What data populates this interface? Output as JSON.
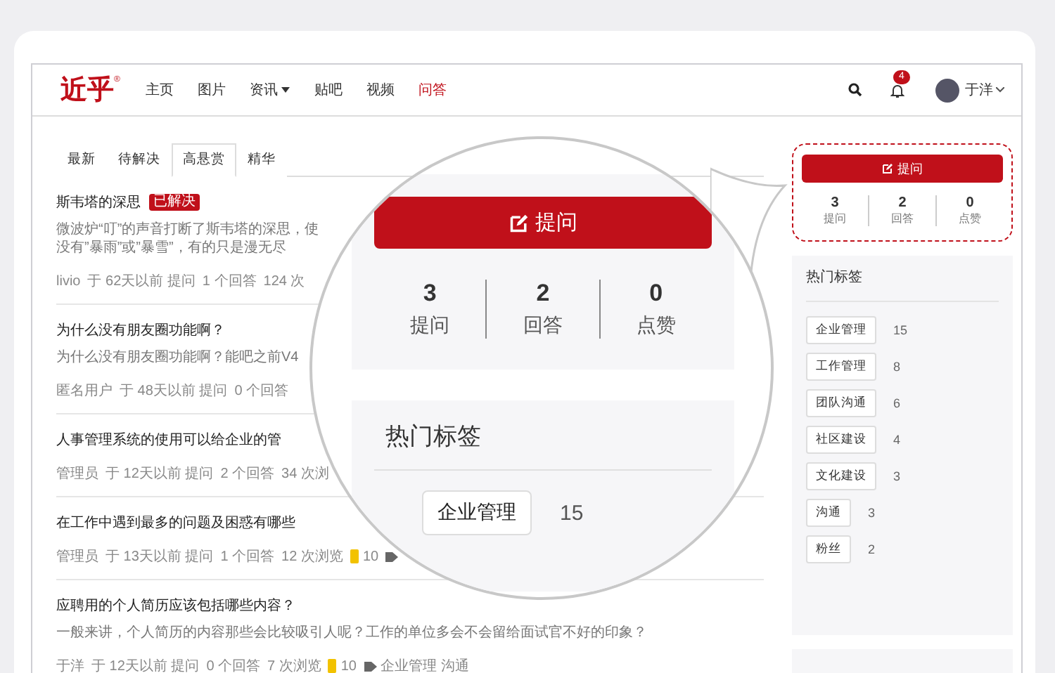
{
  "header": {
    "logo": "近乎",
    "logo_mark": "®",
    "nav": [
      {
        "label": "主页",
        "selected": false,
        "dropdown": false
      },
      {
        "label": "图片",
        "selected": false,
        "dropdown": false
      },
      {
        "label": "资讯",
        "selected": false,
        "dropdown": true
      },
      {
        "label": "贴吧",
        "selected": false,
        "dropdown": false
      },
      {
        "label": "视频",
        "selected": false,
        "dropdown": false
      },
      {
        "label": "问答",
        "selected": true,
        "dropdown": false
      }
    ],
    "notification_count": "4",
    "user_name": "于洋"
  },
  "tabs": [
    {
      "label": "最新",
      "selected": false
    },
    {
      "label": "待解决",
      "selected": false
    },
    {
      "label": "高悬赏",
      "selected": true
    },
    {
      "label": "精华",
      "selected": false
    }
  ],
  "questions": [
    {
      "title": "斯韦塔的深思",
      "badge": "已解决",
      "excerpt_lines": [
        "微波炉“叮”的声音打断了斯韦塔的深思，使",
        "没有”暴雨”或”暴雪”，有的只是漫无尽"
      ],
      "author": "livio",
      "time": "于 62天以前 提问",
      "answers": "1 个回答",
      "views": "124 次",
      "tag_icon": false
    },
    {
      "title": "为什么没有朋友圈功能啊？",
      "excerpt_lines": [
        "为什么没有朋友圈功能啊？能吧之前V4"
      ],
      "author": "匿名用户",
      "time": "于 48天以前 提问",
      "answers": "0 个回答",
      "tag_icon": false
    },
    {
      "title": "人事管理系统的使用可以给企业的管",
      "author": "管理员",
      "time": "于 12天以前 提问",
      "answers": "2 个回答",
      "views": "34 次浏",
      "tag_icon": false
    },
    {
      "title": "在工作中遇到最多的问题及困惑有哪些",
      "author": "管理员",
      "time": "于 13天以前 提问",
      "answers": "1 个回答",
      "views": "12 次浏览",
      "reward": "10",
      "tag_icon": true
    },
    {
      "title": "应聘用的个人简历应该包括哪些内容？",
      "excerpt_lines": [
        "一般来讲，个人简历的内容那些会比较吸引人呢？工作的单位多会不会留给面试官不好的印象？"
      ],
      "author": "于洋",
      "time": "于 12天以前 提问",
      "answers": "0 个回答",
      "views": "7 次浏览",
      "reward": "10",
      "tag_icon": true,
      "tags": [
        "企业管理",
        "沟通"
      ]
    }
  ],
  "sidebar": {
    "ask_button": "提问",
    "stats": [
      {
        "value": "3",
        "label": "提问"
      },
      {
        "value": "2",
        "label": "回答"
      },
      {
        "value": "0",
        "label": "点赞"
      }
    ],
    "tags_title": "热门标签",
    "tags": [
      {
        "name": "企业管理",
        "count": "15"
      },
      {
        "name": "工作管理",
        "count": "8"
      },
      {
        "name": "团队沟通",
        "count": "6"
      },
      {
        "name": "社区建设",
        "count": "4"
      },
      {
        "name": "文化建设",
        "count": "3"
      },
      {
        "name": "沟通",
        "count": "3"
      },
      {
        "name": "粉丝",
        "count": "2"
      }
    ]
  },
  "magnifier": {
    "ask_button": "提问",
    "stats": [
      {
        "value": "3",
        "label": "提问"
      },
      {
        "value": "2",
        "label": "回答"
      },
      {
        "value": "0",
        "label": "点赞"
      }
    ],
    "tags_title": "热门标签",
    "tags": [
      {
        "name": "企业管理",
        "count": "15"
      }
    ]
  }
}
